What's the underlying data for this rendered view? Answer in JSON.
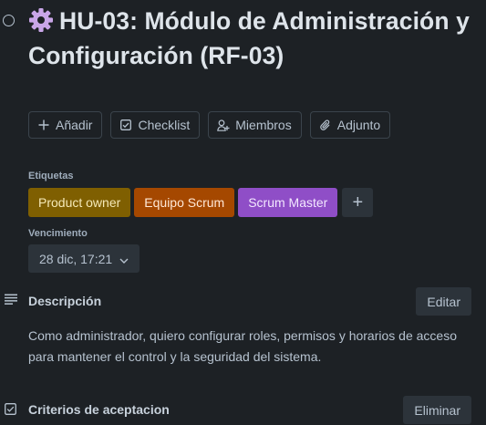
{
  "card": {
    "title": "HU-03: Módulo de Administración y Configuración (RF-03)"
  },
  "actions": [
    {
      "label": "Añadir",
      "icon": "plus-icon"
    },
    {
      "label": "Checklist",
      "icon": "checkbox-icon"
    },
    {
      "label": "Miembros",
      "icon": "add-member-icon"
    },
    {
      "label": "Adjunto",
      "icon": "paperclip-icon"
    }
  ],
  "labels": {
    "heading": "Etiquetas",
    "items": [
      {
        "text": "Product owner",
        "bg": "#7f5f01",
        "fg": "#f5e9b8"
      },
      {
        "text": "Equipo Scrum",
        "bg": "#a54800",
        "fg": "#ffe8d6"
      },
      {
        "text": "Scrum Master",
        "bg": "#8f4ec7",
        "fg": "#f3e8ff"
      }
    ],
    "add_symbol": "+"
  },
  "due": {
    "heading": "Vencimiento",
    "value": "28 dic, 17:21"
  },
  "description": {
    "title": "Descripción",
    "edit_label": "Editar",
    "text": "Como administrador, quiero configurar roles, permisos y horarios de acceso para mantener el control y la seguridad del sistema."
  },
  "checklist": {
    "title": "Criterios de aceptacion",
    "delete_label": "Eliminar"
  }
}
